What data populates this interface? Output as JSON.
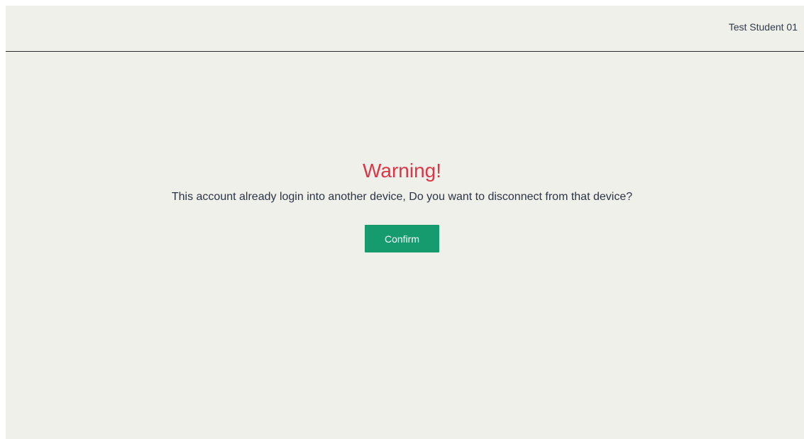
{
  "header": {
    "user_name": "Test Student 01"
  },
  "dialog": {
    "title": "Warning!",
    "message": "This account already login into another device, Do you want to disconnect from that device?",
    "confirm_label": "Confirm"
  },
  "colors": {
    "background": "#f0f0eb",
    "warning": "#dc3545",
    "confirm_button": "#169b6e",
    "text": "#2b3445"
  }
}
